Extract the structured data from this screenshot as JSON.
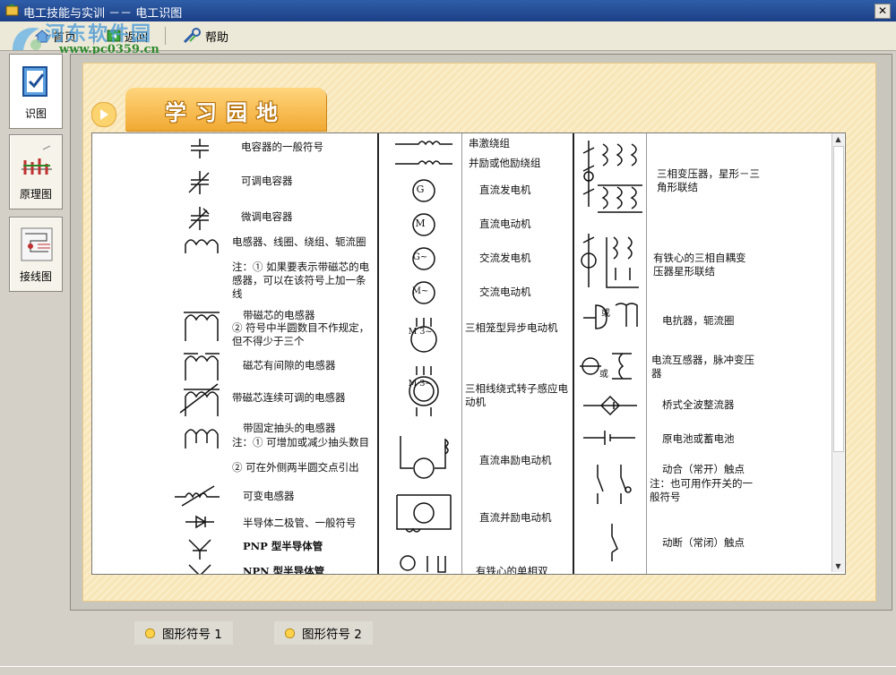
{
  "window": {
    "title": "电工技能与实训 －－ 电工识图",
    "close_glyph": "✕"
  },
  "toolbar": {
    "home": "首页",
    "back": "返回",
    "help": "帮助"
  },
  "watermark": {
    "name": "河东软件园",
    "url": "www.pc0359.cn"
  },
  "sidebar": {
    "items": [
      {
        "label": "识图",
        "icon": "clipboard-check-icon",
        "active": true
      },
      {
        "label": "原理图",
        "icon": "schematic-icon",
        "active": false
      },
      {
        "label": "接线图",
        "icon": "wiring-diagram-icon",
        "active": false
      }
    ]
  },
  "panel": {
    "heading": "学习园地"
  },
  "symbols": {
    "col1": [
      "电容器的一般符号",
      "可调电容器",
      "微调电容器",
      "电感器、线圈、绕组、轭流圈",
      "注：① 如果要表示带磁芯的电感器，可以在该符号上加一条线",
      "带磁芯的电感器",
      "② 符号中半圆数目不作规定，但不得少于三个",
      "磁芯有间隙的电感器",
      "带磁芯连续可调的电感器",
      "带固定抽头的电感器",
      "注：① 可增加或减少抽头数目",
      "② 可在外侧两半圆交点引出",
      "可变电感器",
      "半导体二极管、一般符号",
      "PNP 型半导体管",
      "NPN 型半导体管"
    ],
    "col2": [
      "串激绕组",
      "并励或他励绕组",
      "直流发电机",
      "直流电动机",
      "交流发电机",
      "交流电动机",
      "三相笼型异步电动机",
      "三相线绕式转子感应电动机",
      "直流串励电动机",
      "直流并励电动机",
      "有铁心的单相双"
    ],
    "col2_marks": [
      "G",
      "M",
      "G~",
      "M~",
      "M 3~",
      "M 3~"
    ],
    "col3": [
      "三相变压器，星形－三角形联结",
      "有铁心的三相自耦变压器星形联结",
      "电抗器，轭流圈",
      "电流互感器，脉冲变压器",
      "桥式全波整流器",
      "原电池或蓄电池",
      "动合（常开）触点",
      "注：也可用作开关的一般符号",
      "动断（常闭）触点"
    ],
    "col3_marks": [
      "或",
      "或"
    ]
  },
  "bottom_tabs": [
    "图形符号 1",
    "图形符号 2"
  ]
}
